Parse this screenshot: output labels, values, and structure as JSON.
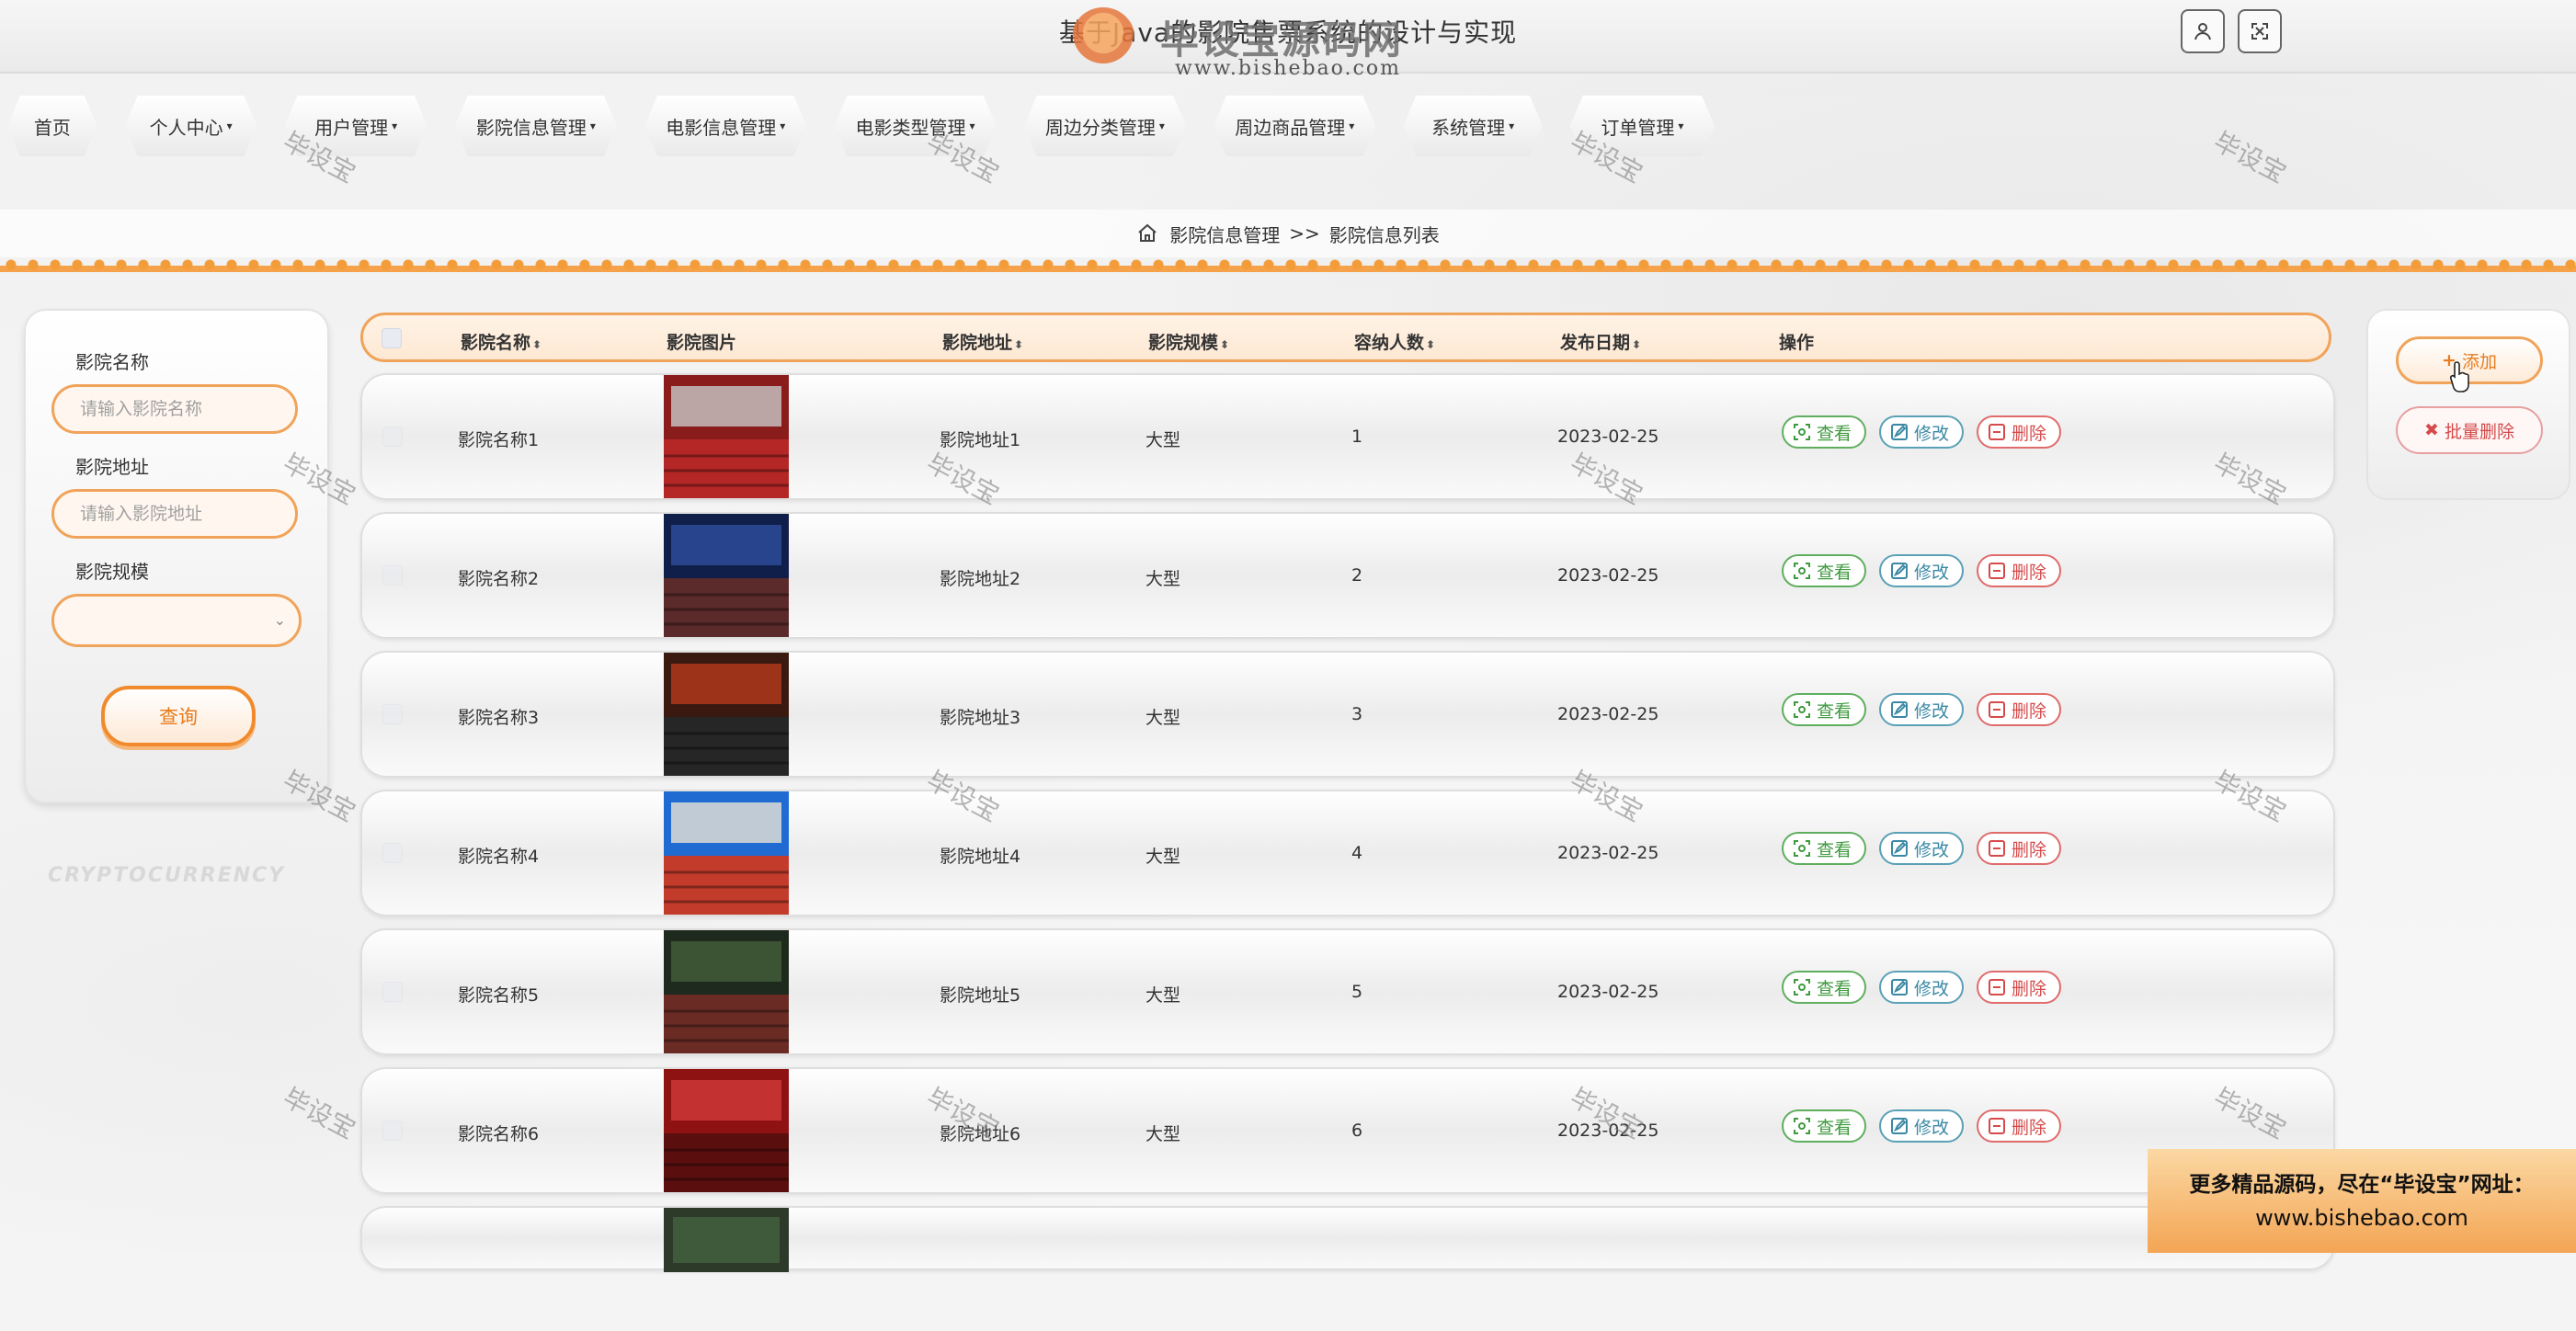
{
  "header": {
    "title": "基于Java的影院售票系统的设计与实现",
    "watermark_logo": "毕设宝源码网",
    "watermark_url": "www.bishebao.com",
    "user_icon": "user-icon",
    "fullscreen_icon": "fullscreen-icon"
  },
  "nav": {
    "items": [
      {
        "label": "首页",
        "dropdown": false
      },
      {
        "label": "个人中心",
        "dropdown": true
      },
      {
        "label": "用户管理",
        "dropdown": true
      },
      {
        "label": "影院信息管理",
        "dropdown": true
      },
      {
        "label": "电影信息管理",
        "dropdown": true
      },
      {
        "label": "电影类型管理",
        "dropdown": true
      },
      {
        "label": "周边分类管理",
        "dropdown": true
      },
      {
        "label": "周边商品管理",
        "dropdown": true
      },
      {
        "label": "系统管理",
        "dropdown": true
      },
      {
        "label": "订单管理",
        "dropdown": true
      }
    ]
  },
  "breadcrumb": {
    "parent": "影院信息管理",
    "separator": ">>",
    "current": "影院信息列表"
  },
  "search": {
    "name_label": "影院名称",
    "name_placeholder": "请输入影院名称",
    "address_label": "影院地址",
    "address_placeholder": "请输入影院地址",
    "scale_label": "影院规模",
    "scale_value": "",
    "query_button": "查询"
  },
  "table": {
    "columns": [
      {
        "label": "影院名称",
        "sortable": true
      },
      {
        "label": "影院图片",
        "sortable": false
      },
      {
        "label": "影院地址",
        "sortable": true
      },
      {
        "label": "影院规模",
        "sortable": true
      },
      {
        "label": "容纳人数",
        "sortable": true
      },
      {
        "label": "发布日期",
        "sortable": true
      },
      {
        "label": "操作",
        "sortable": false
      }
    ],
    "sort_glyph": "⬍",
    "rows": [
      {
        "name": "影院名称1",
        "address": "影院地址1",
        "scale": "大型",
        "capacity": "1",
        "date": "2023-02-25"
      },
      {
        "name": "影院名称2",
        "address": "影院地址2",
        "scale": "大型",
        "capacity": "2",
        "date": "2023-02-25"
      },
      {
        "name": "影院名称3",
        "address": "影院地址3",
        "scale": "大型",
        "capacity": "3",
        "date": "2023-02-25"
      },
      {
        "name": "影院名称4",
        "address": "影院地址4",
        "scale": "大型",
        "capacity": "4",
        "date": "2023-02-25"
      },
      {
        "name": "影院名称5",
        "address": "影院地址5",
        "scale": "大型",
        "capacity": "5",
        "date": "2023-02-25"
      },
      {
        "name": "影院名称6",
        "address": "影院地址6",
        "scale": "大型",
        "capacity": "6",
        "date": "2023-02-25"
      }
    ],
    "ops": {
      "view": "查看",
      "edit": "修改",
      "delete": "删除"
    }
  },
  "actions": {
    "add": "添加",
    "batch_delete": "批量删除"
  },
  "watermark": "毕设宝",
  "background_text": "CRYPTOCURRENCY",
  "promo": {
    "line1": "更多精品源码，尽在“毕设宝”网址：",
    "line2": "www.bishebao.com"
  },
  "colors": {
    "accent": "#f0a35a",
    "accent_text": "#e77b1d",
    "view": "#3f9a3f",
    "edit": "#3a88a3",
    "delete": "#d64a4a"
  }
}
